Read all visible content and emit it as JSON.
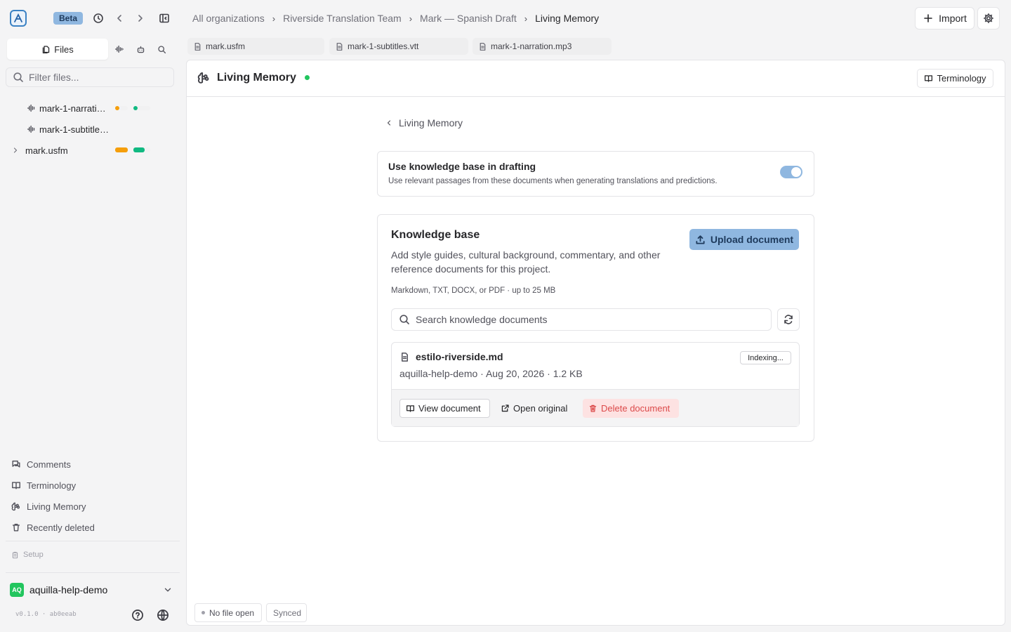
{
  "app": {
    "beta_label": "Beta"
  },
  "breadcrumb": [
    "All organizations",
    "Riverside Translation Team",
    "Mark — Spanish Draft",
    "Living Memory"
  ],
  "header": {
    "import_label": "Import"
  },
  "sidebar": {
    "tab_files": "Files",
    "filter_placeholder": "Filter files...",
    "files": [
      {
        "name": "mark-1-narration.mp3",
        "display": "mark-1-narratio…"
      },
      {
        "name": "mark-1-subtitles.vtt",
        "display": "mark-1-subtitles…"
      },
      {
        "name": "mark.usfm",
        "display": "mark.usfm"
      }
    ],
    "nav": [
      "Comments",
      "Terminology",
      "Living Memory",
      "Recently deleted"
    ],
    "setup_label": "Setup",
    "org": {
      "avatar": "AQ",
      "name": "aquilla-help-demo"
    },
    "version": "v0.1.0 · ab0eeab"
  },
  "doc_tabs": [
    "mark.usfm",
    "mark-1-subtitles.vtt",
    "mark-1-narration.mp3"
  ],
  "panel": {
    "title": "Living Memory",
    "terminology_button": "Terminology",
    "back_label": "Living Memory",
    "setting": {
      "title": "Use knowledge base in drafting",
      "description": "Use relevant passages from these documents when generating translations and predictions.",
      "enabled": true
    },
    "kb": {
      "title": "Knowledge base",
      "description_line1": "Add style guides, cultural background, commentary, and other",
      "description_line2": "reference documents for this project.",
      "upload_label": "Upload document",
      "formats": "Markdown, TXT, DOCX, or PDF · up to 25 MB",
      "search_placeholder": "Search knowledge documents",
      "document": {
        "name": "estilo-riverside.md",
        "meta": "aquilla-help-demo · Aug 20, 2026 · 1.2 KB",
        "status": "Indexing...",
        "view_label": "View document",
        "open_label": "Open original",
        "delete_label": "Delete document"
      }
    }
  },
  "footer": {
    "file_status": "No file open",
    "sync_status": "Synced"
  },
  "colors": {
    "accent": "#8fb7e0",
    "online": "#22c55e",
    "narration_status_a": "#f59e0b",
    "narration_status_b": "#10b981",
    "usfm_status_a": "#f59e0b",
    "usfm_status_b": "#10b981",
    "danger": "#dc4a4a"
  }
}
